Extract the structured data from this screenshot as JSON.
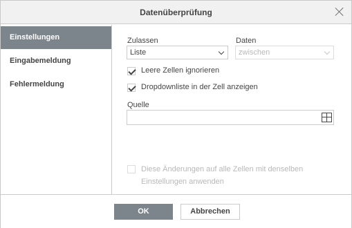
{
  "dialog": {
    "title": "Datenüberprüfung"
  },
  "sidebar": {
    "items": [
      {
        "label": "Einstellungen",
        "active": true
      },
      {
        "label": "Eingabemeldung",
        "active": false
      },
      {
        "label": "Fehlermeldung",
        "active": false
      }
    ]
  },
  "settings": {
    "allow_label": "Zulassen",
    "allow_value": "Liste",
    "data_label": "Daten",
    "data_value": "zwischen",
    "ignore_blank_label": "Leere Zellen ignorieren",
    "ignore_blank_checked": true,
    "in_cell_dropdown_label": "Dropdownliste in der Zell anzeigen",
    "in_cell_dropdown_checked": true,
    "source_label": "Quelle",
    "source_value": "",
    "apply_all_label": "Diese Änderungen auf alle Zellen mit denselben Einstellungen anwenden",
    "apply_all_checked": false
  },
  "footer": {
    "ok_label": "OK",
    "cancel_label": "Abbrechen"
  },
  "icons": {
    "close": "close-icon",
    "range_select": "range-select-icon"
  },
  "colors": {
    "accent": "#7d858c",
    "title_bar": "#f1f1f1",
    "border": "#cbcbcb"
  }
}
